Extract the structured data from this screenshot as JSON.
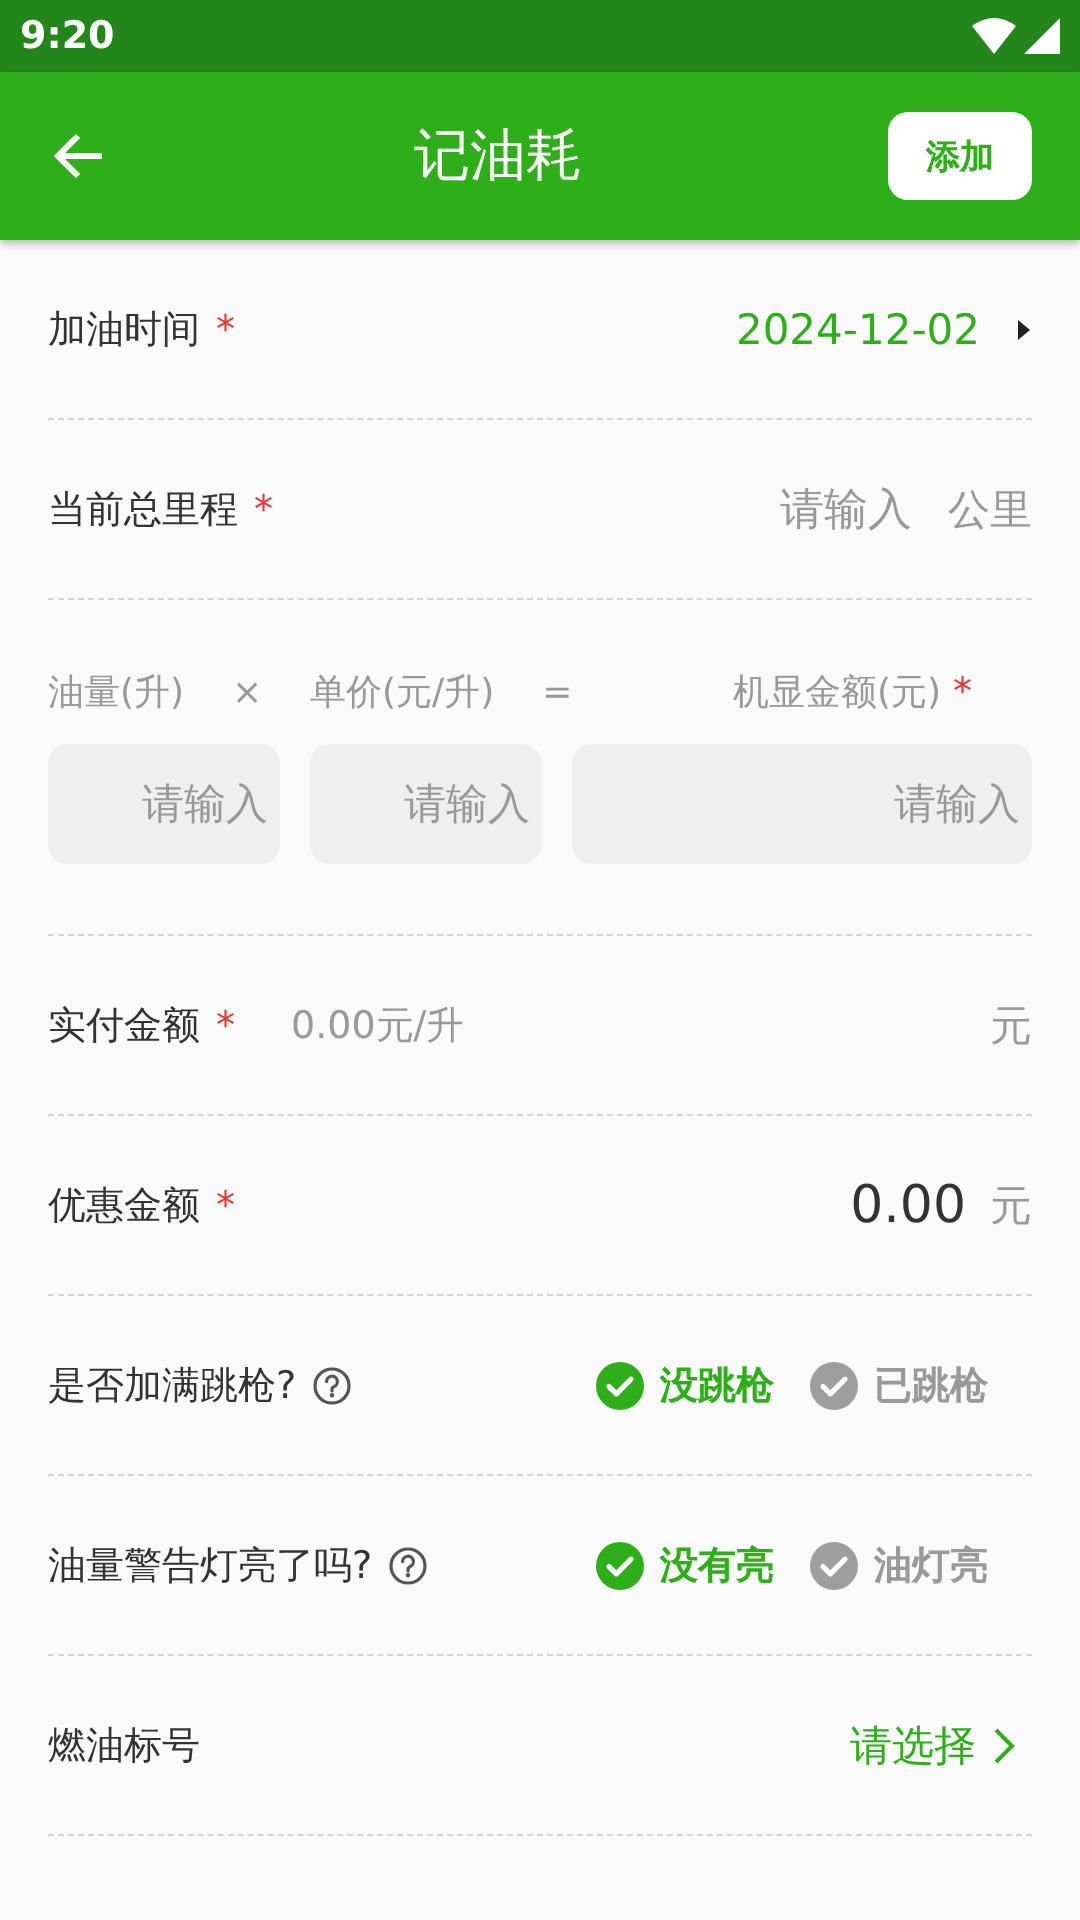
{
  "status_bar": {
    "time": "9:20"
  },
  "app_bar": {
    "title": "记油耗",
    "action": "添加"
  },
  "rows": [
    {
      "kind": "date",
      "label": "加油时间",
      "mark": "*",
      "value": "2024-12-02"
    },
    {
      "kind": "input",
      "label": "当前总里程",
      "mark": "*",
      "placeholder": "请输入",
      "unit": "公里"
    },
    {
      "kind": "calc",
      "fields": [
        {
          "label": "油量(升)",
          "operator": "×",
          "placeholder": "请输入"
        },
        {
          "label": "单价(元/升)",
          "operator": "=",
          "placeholder": "请输入"
        },
        {
          "label": "机显金额(元)",
          "mark": "*",
          "placeholder": "请输入"
        }
      ]
    },
    {
      "kind": "paid",
      "label": "实付金额",
      "mark": "*",
      "hint": "0.00元/升",
      "unit": "元"
    },
    {
      "kind": "amount",
      "label": "优惠金额",
      "mark": "*",
      "value": "0.00",
      "unit": "元"
    },
    {
      "kind": "choice",
      "label": "是否加满跳枪?",
      "help": true,
      "options": [
        {
          "label": "没跳枪",
          "selected": true
        },
        {
          "label": "已跳枪",
          "selected": false
        }
      ]
    },
    {
      "kind": "choice",
      "label": "油量警告灯亮了吗?",
      "help": true,
      "options": [
        {
          "label": "没有亮",
          "selected": true
        },
        {
          "label": "油灯亮",
          "selected": false
        }
      ]
    },
    {
      "kind": "select",
      "label": "燃油标号",
      "value": "请选择"
    }
  ]
}
